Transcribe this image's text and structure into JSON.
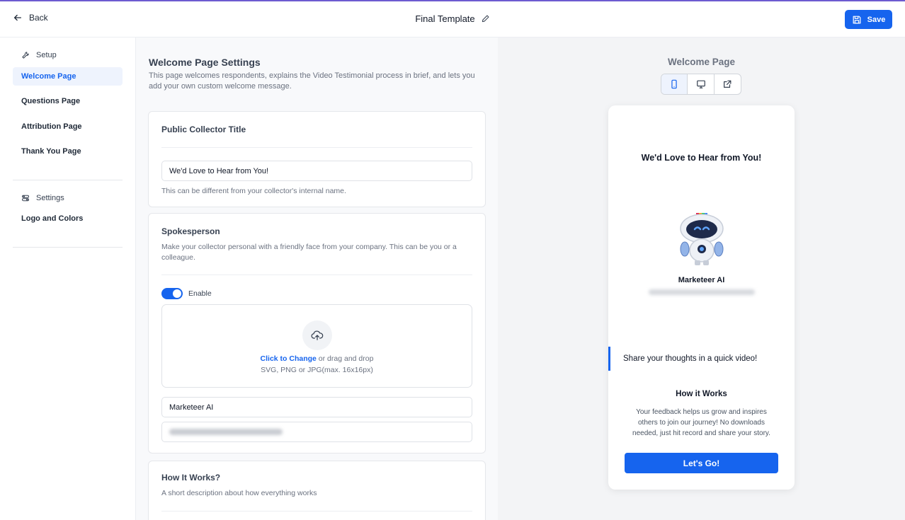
{
  "header": {
    "back_label": "Back",
    "template_title": "Final Template",
    "save_label": "Save"
  },
  "sidebar": {
    "setup_heading": "Setup",
    "setup_items": [
      {
        "label": "Welcome Page",
        "active": true
      },
      {
        "label": "Questions Page",
        "active": false
      },
      {
        "label": "Attribution Page",
        "active": false
      },
      {
        "label": "Thank You Page",
        "active": false
      }
    ],
    "settings_heading": "Settings",
    "settings_items": [
      {
        "label": "Logo and Colors",
        "active": false
      }
    ]
  },
  "settings_panel": {
    "title": "Welcome Page Settings",
    "description": "This page welcomes respondents, explains the Video Testimonial process in brief, and lets you add your own custom welcome message.",
    "public_title": {
      "heading": "Public Collector Title",
      "value": "We'd Love to Hear from You!",
      "hint": "This can be different from your collector's internal name."
    },
    "spokesperson": {
      "heading": "Spokesperson",
      "description": "Make your collector personal with a friendly face from your company. This can be you or a colleague.",
      "enable_label": "Enable",
      "enabled": true,
      "upload_link": "Click to Change",
      "upload_rest": " or drag and drop",
      "upload_formats": "SVG, PNG or JPG(max. 16x16px)",
      "name_value": "Marketeer AI"
    },
    "how_it_works": {
      "heading": "How It Works?",
      "description": "A short description about how everything works"
    }
  },
  "preview": {
    "title": "Welcome Page",
    "device_icons": [
      "mobile-icon",
      "desktop-icon",
      "external-link-icon"
    ],
    "active_device": "mobile",
    "headline": "We'd Love to Hear from You!",
    "spokesperson_name": "Marketeer AI",
    "quote": "Share your thoughts in a quick video!",
    "how_heading": "How it Works",
    "how_text": "Your feedback helps us grow and inspires others to join our journey! No downloads needed, just hit record and share your story.",
    "cta_label": "Let's Go!"
  },
  "colors": {
    "accent": "#1664ee",
    "top_line": "#6d5bd0"
  }
}
